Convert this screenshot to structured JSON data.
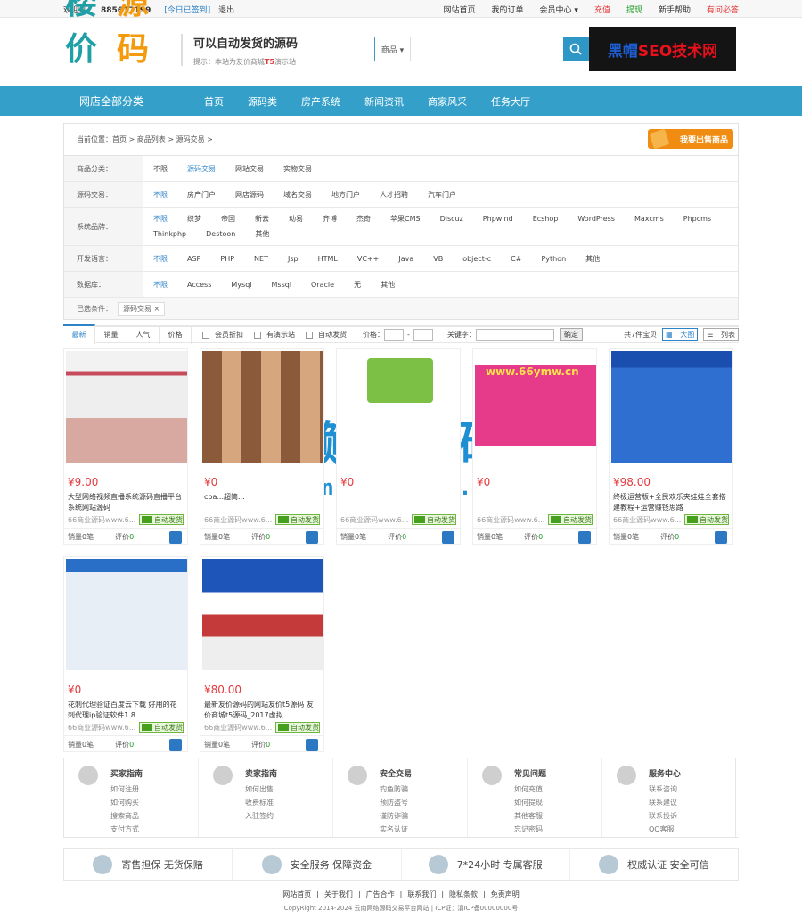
{
  "topbar": {
    "welcome": "欢迎您：",
    "uid": "885617199",
    "signin": "[今日已签到]",
    "logout": "退出",
    "links": [
      {
        "label": "网站首页",
        "cls": ""
      },
      {
        "label": "我的订单",
        "cls": ""
      },
      {
        "label": "会员中心 ▾",
        "cls": ""
      },
      {
        "label": "充值",
        "cls": "red"
      },
      {
        "label": "提现",
        "cls": "grn"
      },
      {
        "label": "新手帮助",
        "cls": ""
      },
      {
        "label": "有问必答",
        "cls": "red"
      }
    ]
  },
  "header": {
    "logo_a": "楼价",
    "logo_b": "源码",
    "slogan": "可以自动发货的源码",
    "tip_prefix": "提示：本站为友价商城",
    "tip_version": "T5",
    "tip_suffix": "演示站",
    "search_type": "商品 ▾",
    "search_placeholder": "",
    "ad_pre": "黑帽",
    "ad_main": "SEO技术网"
  },
  "nav": {
    "all": "网店全部分类",
    "items": [
      "首页",
      "源码类",
      "房产系统",
      "新闻资讯",
      "商家风采",
      "任务大厅"
    ]
  },
  "filter": {
    "crumb": "当前位置：首页 > 商品列表 > 源码交易 >",
    "sell_btn": "我要出售商品",
    "rows": [
      {
        "label": "商品分类：",
        "opts": [
          "不限",
          "源码交易",
          "网站交易",
          "实物交易"
        ],
        "on": 1
      },
      {
        "label": "源码交易：",
        "opts": [
          "不限",
          "房产门户",
          "网店源码",
          "域名交易",
          "地方门户",
          "人才招聘",
          "汽车门户"
        ],
        "on": 0
      },
      {
        "label": "系统品牌：",
        "opts": [
          "不限",
          "织梦",
          "帝国",
          "新云",
          "动易",
          "齐博",
          "杰奇",
          "苹果CMS",
          "Discuz",
          "Phpwind",
          "Ecshop",
          "WordPress",
          "Maxcms",
          "Phpcms",
          "Thinkphp",
          "Destoon",
          "其他"
        ],
        "on": 0,
        "tall": true
      },
      {
        "label": "开发语言：",
        "opts": [
          "不限",
          "ASP",
          "PHP",
          "NET",
          "Jsp",
          "HTML",
          "VC++",
          "Java",
          "VB",
          "object-c",
          "C#",
          "Python",
          "其他"
        ],
        "on": 0
      },
      {
        "label": "数据库：",
        "opts": [
          "不限",
          "Access",
          "Mysql",
          "Mssql",
          "Oracle",
          "无",
          "其他"
        ],
        "on": 0
      }
    ],
    "chosen_label": "已选条件：",
    "chosen_tag": "源码交易 ×"
  },
  "sortbar": {
    "tabs": [
      "最新",
      "销量",
      "人气",
      "价格"
    ],
    "checks": [
      "会员折扣",
      "有演示站",
      "自动发货"
    ],
    "price_label": "价格：",
    "dash": "-",
    "keyword_label": "关键字：",
    "ok": "确定",
    "total": "共7件宝贝",
    "view_big": "大图",
    "view_list": "列表"
  },
  "products": [
    {
      "price": "¥9.00",
      "title": "大型网络视频直播系统源码直播平台系统网站源码",
      "shop": "66商业源码www.6..."
    },
    {
      "price": "¥0",
      "title": "cpa...超简...",
      "shop": "66商业源码www.6..."
    },
    {
      "price": "¥0",
      "title": "",
      "shop": "66商业源码www.6..."
    },
    {
      "price": "¥0",
      "title": "",
      "shop": "66商业源码www.6..."
    },
    {
      "price": "¥98.00",
      "title": "终极运营版+全民欢乐夹娃娃全套搭建教程+运营赚钱思路",
      "shop": "66商业源码www.6..."
    },
    {
      "price": "¥0",
      "title": "花刺代理验证百度云下载 好用的花刺代理ip验证软件1.8",
      "shop": "66商业源码www.6..."
    },
    {
      "price": "¥80.00",
      "title": "最新友价源码的网站友价t5源码 友价商城t5源码_2017虚拟",
      "shop": "66商业源码www.6..."
    }
  ],
  "product_common": {
    "auto": "自动发货",
    "sales": "销量0笔",
    "reviews": "评价",
    "reviews_n": "0"
  },
  "watermark": {
    "line1": "懒人源码",
    "line2": "lanrenzhijia.com",
    "card4_banner": "www.66ymw.cn"
  },
  "help": [
    {
      "title": "买家指南",
      "links": [
        "如何注册",
        "如何购买",
        "搜索商品",
        "支付方式"
      ]
    },
    {
      "title": "卖家指南",
      "links": [
        "如何出售",
        "收费标准",
        "入驻签约"
      ]
    },
    {
      "title": "安全交易",
      "links": [
        "钓鱼防骗",
        "预防盗号",
        "谨防诈骗",
        "实名认证"
      ]
    },
    {
      "title": "常见问题",
      "links": [
        "如何充值",
        "如何提现",
        "其他客服",
        "忘记密码"
      ]
    },
    {
      "title": "服务中心",
      "links": [
        "联系咨询",
        "联系建议",
        "联系投诉",
        "QQ客服"
      ]
    }
  ],
  "guarantee": [
    "寄售担保 无货保赔",
    "安全服务 保障资金",
    "7*24小时 专属客服",
    "权威认证 安全可信"
  ],
  "footer": {
    "links": [
      "网站首页",
      "关于我们",
      "广告合作",
      "联系我们",
      "隐私条款",
      "免责声明"
    ],
    "copy": "CopyRight 2014-2024 云南网络源码交易平台网站 | ICP证：滇ICP备00000000号"
  }
}
